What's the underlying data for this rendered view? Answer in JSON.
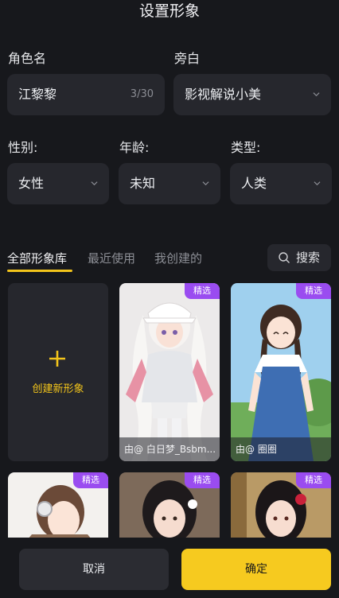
{
  "header": {
    "title": "设置形象"
  },
  "form": {
    "name_label": "角色名",
    "name_value": "江黎黎",
    "name_count": "3/30",
    "voice_label": "旁白",
    "voice_value": "影视解说小美",
    "gender_label": "性别:",
    "gender_value": "女性",
    "age_label": "年龄:",
    "age_value": "未知",
    "type_label": "类型:",
    "type_value": "人类"
  },
  "tabs": [
    {
      "label": "全部形象库",
      "active": true
    },
    {
      "label": "最近使用",
      "active": false
    },
    {
      "label": "我创建的",
      "active": false
    }
  ],
  "search": {
    "label": "搜索"
  },
  "create": {
    "label": "创建新形象"
  },
  "cards": [
    {
      "badge": "精选",
      "caption": "由@ 白日梦_Bsbm..."
    },
    {
      "badge": "精选",
      "caption": "由@ 圈圈"
    },
    {
      "badge": "精选",
      "caption": ""
    },
    {
      "badge": "精选",
      "caption": ""
    },
    {
      "badge": "精选",
      "caption": ""
    }
  ],
  "footer": {
    "cancel_label": "取消",
    "confirm_label": "确定"
  },
  "colors": {
    "accent": "#f3c51b",
    "badge": "#9a4cf0",
    "background": "#17181c",
    "field": "#26272d"
  }
}
